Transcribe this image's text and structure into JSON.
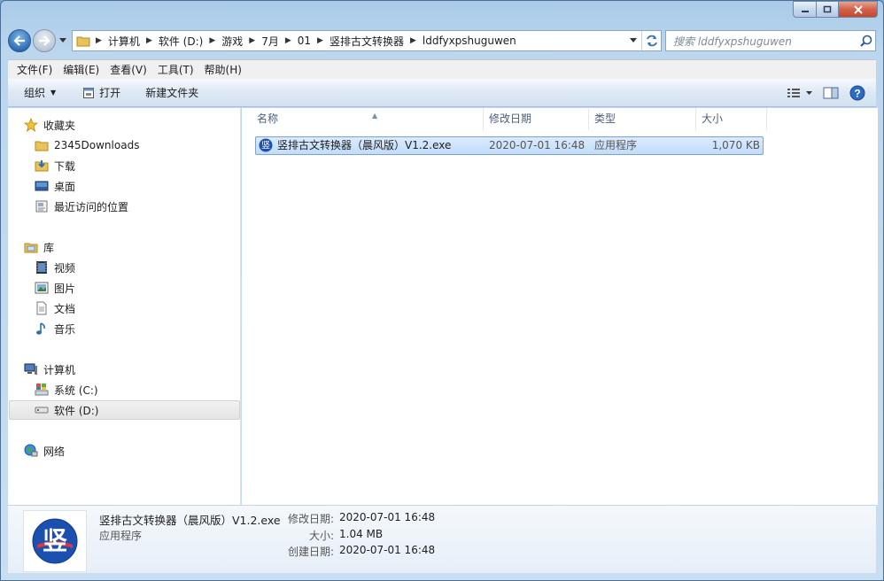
{
  "window": {
    "caption_buttons": [
      "minimize",
      "maximize",
      "close"
    ]
  },
  "address": {
    "crumbs": [
      "计算机",
      "软件 (D:)",
      "游戏",
      "7月",
      "01",
      "竖排古文转换器",
      "lddfyxpshuguwen"
    ]
  },
  "search": {
    "placeholder": "搜索 lddfyxpshuguwen"
  },
  "menubar": {
    "items": [
      "文件(F)",
      "编辑(E)",
      "查看(V)",
      "工具(T)",
      "帮助(H)"
    ]
  },
  "toolbar": {
    "organize_label": "组织",
    "open_label": "打开",
    "new_folder_label": "新建文件夹"
  },
  "navpane": {
    "favorites": {
      "label": "收藏夹",
      "items": [
        "2345Downloads",
        "下载",
        "桌面",
        "最近访问的位置"
      ]
    },
    "libraries": {
      "label": "库",
      "items": [
        "视频",
        "图片",
        "文档",
        "音乐"
      ]
    },
    "computer": {
      "label": "计算机",
      "items": [
        "系统 (C:)",
        "软件 (D:)"
      ],
      "selected": "软件 (D:)"
    },
    "network": {
      "label": "网络"
    }
  },
  "columns": {
    "name": "名称",
    "modified": "修改日期",
    "type": "类型",
    "size": "大小"
  },
  "files": [
    {
      "name": "竖排古文转换器（晨风版）V1.2.exe",
      "modified": "2020-07-01 16:48",
      "type": "应用程序",
      "size": "1,070 KB",
      "icon_glyph": "竖"
    }
  ],
  "details": {
    "name": "竖排古文转换器（晨风版）V1.2.exe",
    "type": "应用程序",
    "modified_label": "修改日期:",
    "modified_value": "2020-07-01 16:48",
    "size_label": "大小:",
    "size_value": "1.04 MB",
    "created_label": "创建日期:",
    "created_value": "2020-07-01 16:48",
    "icon_glyph": "竖"
  },
  "colors": {
    "accent": "#2f6fb4",
    "selection": "#c1dcfc",
    "icon_blue": "#1b4fb0"
  }
}
